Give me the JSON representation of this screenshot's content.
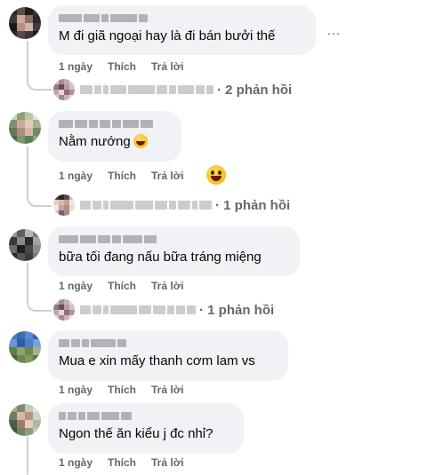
{
  "comments": [
    {
      "text": "M đi giã ngoại hay là đi bán bưởi thế",
      "time": "1 ngày",
      "like": "Thích",
      "reply": "Trả lời",
      "replies_summary": "· 2 phản hồi",
      "more_icon": "…"
    },
    {
      "text": "Nằm nướng",
      "emoji": "rolling-laughing-emoji",
      "time": "1 ngày",
      "like": "Thích",
      "reply": "Trả lời",
      "reaction": "laughing-reaction-icon",
      "replies_summary": "· 1 phản hồi"
    },
    {
      "text": "bữa tối đang nấu bữa tráng miệng",
      "time": "1 ngày",
      "like": "Thích",
      "reply": "Trả lời",
      "replies_summary": "· 1 phản hồi"
    },
    {
      "text": "Mua e xin mấy thanh cơm lam vs",
      "time": "1 ngày",
      "like": "Thích",
      "reply": "Trả lời"
    },
    {
      "text": "Ngon thế ăn kiểu j đc nhỉ?",
      "time": "1 ngày",
      "like": "Thích",
      "reply": "Trả lời"
    }
  ],
  "colors": {
    "bubble": "#f0f2f5",
    "secondary_text": "#65676b",
    "primary_text": "#050505"
  }
}
